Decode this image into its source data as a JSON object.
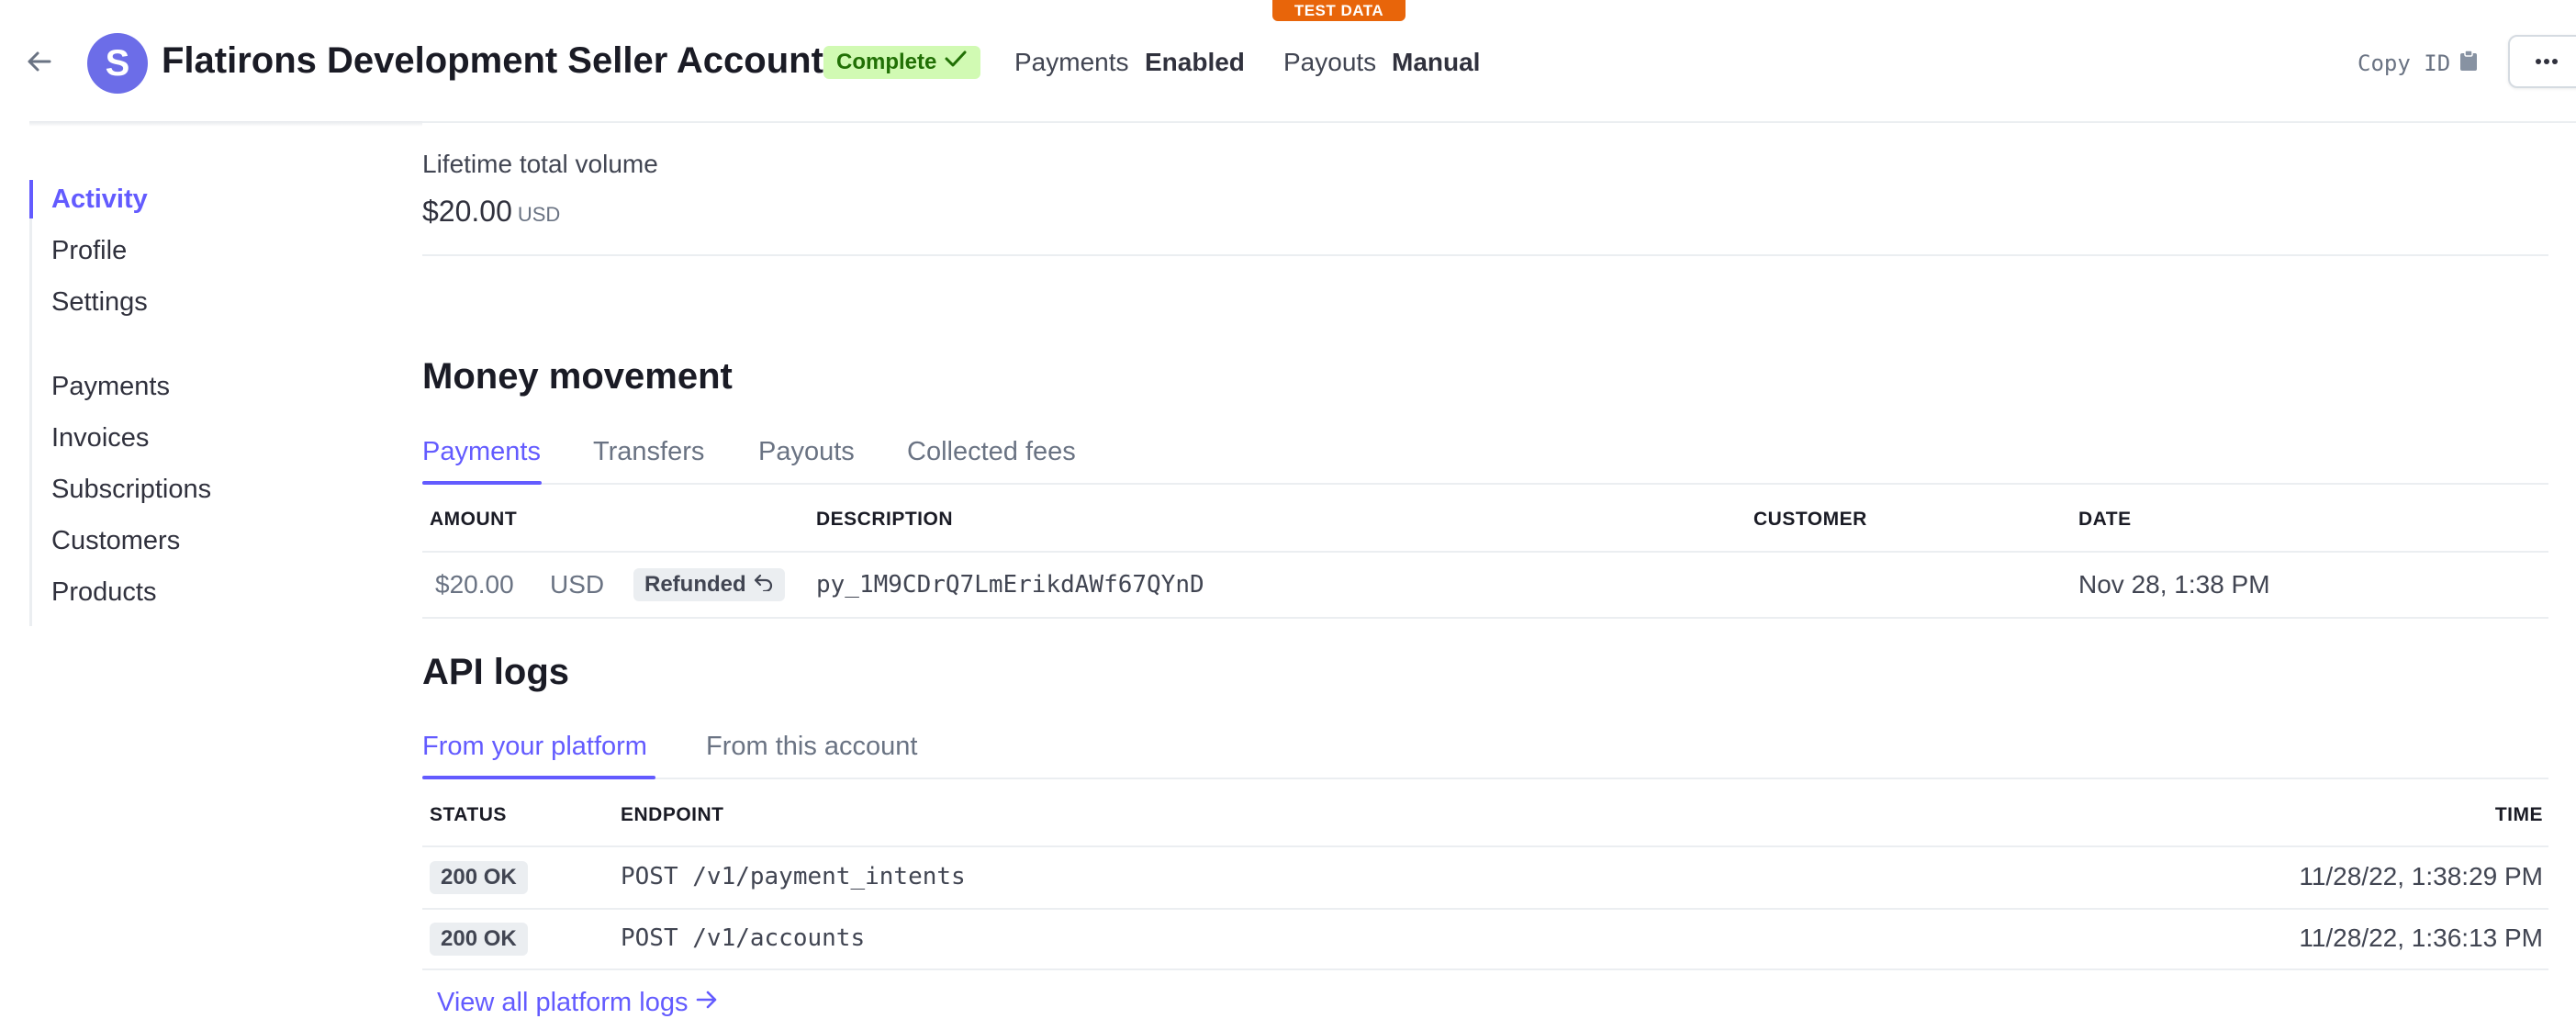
{
  "banner": {
    "test_data": "TEST DATA"
  },
  "header": {
    "avatar_letter": "S",
    "title": "Flatirons Development Seller Account",
    "status_badge": "Complete",
    "payments_label": "Payments",
    "payments_value": "Enabled",
    "payouts_label": "Payouts",
    "payouts_value": "Manual",
    "copy_id": "Copy ID"
  },
  "sidebar": {
    "primary": [
      {
        "label": "Activity",
        "active": true
      },
      {
        "label": "Profile"
      },
      {
        "label": "Settings"
      }
    ],
    "secondary": [
      {
        "label": "Payments"
      },
      {
        "label": "Invoices"
      },
      {
        "label": "Subscriptions"
      },
      {
        "label": "Customers"
      },
      {
        "label": "Products"
      }
    ]
  },
  "lifetime": {
    "label": "Lifetime total volume",
    "value": "$20.00",
    "currency": "USD"
  },
  "money_movement": {
    "title": "Money movement",
    "tabs": [
      "Payments",
      "Transfers",
      "Payouts",
      "Collected fees"
    ],
    "active_tab": "Payments",
    "columns": [
      "AMOUNT",
      "DESCRIPTION",
      "CUSTOMER",
      "DATE"
    ],
    "rows": [
      {
        "amount": "$20.00",
        "currency": "USD",
        "status": "Refunded",
        "description": "py_1M9CDrQ7LmErikdAWf67QYnD",
        "customer": "",
        "date": "Nov 28, 1:38 PM"
      }
    ]
  },
  "api_logs": {
    "title": "API logs",
    "tabs": [
      "From your platform",
      "From this account"
    ],
    "active_tab": "From your platform",
    "columns": [
      "STATUS",
      "ENDPOINT",
      "TIME"
    ],
    "rows": [
      {
        "status": "200 OK",
        "endpoint": "POST /v1/payment_intents",
        "time": "11/28/22, 1:38:29 PM"
      },
      {
        "status": "200 OK",
        "endpoint": "POST /v1/accounts",
        "time": "11/28/22, 1:36:13 PM"
      }
    ],
    "view_all": "View all platform logs"
  },
  "colors": {
    "accent": "#635bff",
    "test_banner": "#e8650a",
    "complete_bg": "#d1fab3",
    "complete_text": "#217005"
  }
}
